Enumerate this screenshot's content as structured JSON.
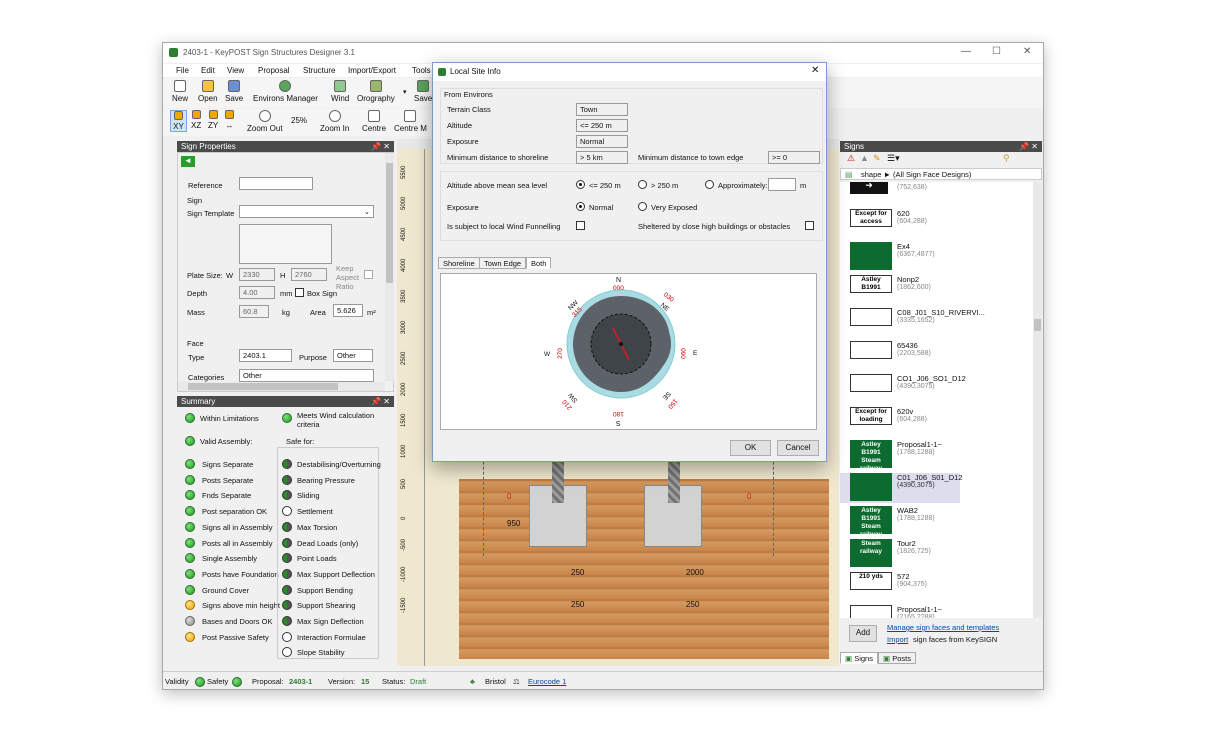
{
  "window": {
    "title": "2403-1 - KeyPOST Sign Structures Designer 3.1",
    "min": "—",
    "max": "☐",
    "close": "✕"
  },
  "menu": [
    "File",
    "Edit",
    "View",
    "Proposal",
    "Structure",
    "Import/Export",
    "Tools"
  ],
  "toolbar": {
    "new": "New",
    "open": "Open",
    "save": "Save",
    "environs": "Environs Manager",
    "wind": "Wind",
    "orography": "Orography",
    "save2": "Save"
  },
  "viewbar": {
    "xy": "XY",
    "xz": "XZ",
    "zy": "ZY",
    "arrows": "↔",
    "zoom_out": "Zoom Out",
    "zoom_level": "25%",
    "zoom_in": "Zoom In",
    "centre": "Centre",
    "centre_m": "Centre M"
  },
  "sign_props": {
    "title": "Sign Properties",
    "pin": "📌 ✕",
    "reference": "Reference",
    "sign": "Sign",
    "template": "Sign Template",
    "plate_size": "Plate Size:",
    "w": "W",
    "w_val": "2330",
    "h": "H",
    "h_val": "2760",
    "keep_aspect": "Keep Aspect Ratio",
    "depth": "Depth",
    "depth_val": "4.00",
    "mm": "mm",
    "box_sign": "Box Sign",
    "mass": "Mass",
    "mass_val": "60.8",
    "kg": "kg",
    "area": "Area",
    "area_val": "5.626",
    "m2": "m²",
    "face": "Face",
    "type": "Type",
    "type_val": "2403.1",
    "purpose": "Purpose",
    "purpose_val": "Other",
    "categories": "Categories",
    "categories_val": "Other"
  },
  "summary": {
    "title": "Summary",
    "within": "Within Limitations",
    "meets": "Meets Wind calculation criteria",
    "valid": "Valid Assembly:",
    "safe_for": "Safe for:",
    "left": [
      {
        "t": "Signs Separate",
        "c": "g"
      },
      {
        "t": "Posts Separate",
        "c": "g"
      },
      {
        "t": "Fnds Separate",
        "c": "g"
      },
      {
        "t": "Post separation OK",
        "c": "g"
      },
      {
        "t": "Signs all in Assembly",
        "c": "g"
      },
      {
        "t": "Posts all in Assembly",
        "c": "g"
      },
      {
        "t": "Single Assembly",
        "c": "g"
      },
      {
        "t": "Posts have Foundation",
        "c": "g"
      },
      {
        "t": "Ground Cover",
        "c": "g"
      },
      {
        "t": "Signs above min height",
        "c": "o"
      },
      {
        "t": "Bases and Doors OK",
        "c": "x"
      },
      {
        "t": "Post Passive Safety",
        "c": "o"
      }
    ],
    "right": [
      {
        "t": "Destabilising/Overturning",
        "c": "h"
      },
      {
        "t": "Bearing Pressure",
        "c": "h"
      },
      {
        "t": "Sliding",
        "c": "h"
      },
      {
        "t": "Settlement",
        "c": "w"
      },
      {
        "t": "Max Torsion",
        "c": "h"
      },
      {
        "t": "Dead Loads (only)",
        "c": "h"
      },
      {
        "t": "Point Loads",
        "c": "h"
      },
      {
        "t": "Max Support Deflection",
        "c": "h"
      },
      {
        "t": "Support Bending",
        "c": "h"
      },
      {
        "t": "Support Shearing",
        "c": "h"
      },
      {
        "t": "Max Sign Deflection",
        "c": "h"
      },
      {
        "t": "Interaction Formulae",
        "c": "w"
      },
      {
        "t": "Slope Stability",
        "c": "w"
      }
    ]
  },
  "drawing": {
    "ruler": [
      "5500",
      "5000",
      "4500",
      "4000",
      "3500",
      "3000",
      "2500",
      "2000",
      "1500",
      "1000",
      "500",
      "0",
      "-500",
      "-1000",
      "-1500"
    ],
    "dim1": "950",
    "dim2": "250",
    "dim3": "2000",
    "dim4": "250",
    "dim5": "250",
    "zero1": "0",
    "zero2": "0"
  },
  "dialog": {
    "title": "Local Site Info",
    "close": "✕",
    "group": "From Environs",
    "terrain": "Terrain Class",
    "terrain_val": "Town",
    "altitude": "Altitude",
    "altitude_val": "<= 250 m",
    "exposure": "Exposure",
    "exposure_val": "Normal",
    "min_shore": "Minimum distance to shoreline",
    "min_shore_val": "> 5 km",
    "min_town": "Minimum distance to town edge",
    "min_town_val": ">= 0",
    "alt_msl": "Altitude above mean sea level",
    "opt_le250": "<= 250 m",
    "opt_gt250": "> 250 m",
    "opt_approx": "Approximately:",
    "approx_unit": "m",
    "exposure2": "Exposure",
    "opt_normal": "Normal",
    "opt_very": "Very Exposed",
    "funnel": "Is subject to local Wind Funnelling",
    "sheltered": "Sheltered by close high buildings or obstacles",
    "tabs": [
      "Shoreline",
      "Town Edge",
      "Both"
    ],
    "ok": "OK",
    "cancel": "Cancel",
    "compass": {
      "n": "N",
      "n_deg": "000",
      "ne": "NE",
      "ne_deg": "030",
      "e": "E",
      "e_deg": "090",
      "se": "SE",
      "se_deg": "150",
      "s": "S",
      "s_deg": "180",
      "sw": "SW",
      "sw_deg": "210",
      "w": "W",
      "w_deg": "270",
      "nw": "NW",
      "nw_deg": "315"
    }
  },
  "signs": {
    "title": "Signs",
    "pin": "📌 ✕",
    "breadcrumb": "shape ► (All Sign Face Designs)",
    "top_size": "(752,638)",
    "items": [
      {
        "name": "620",
        "size": "(604,288)",
        "thumb": "Except for access",
        "style": "white"
      },
      {
        "name": "Ex4",
        "size": "(6367,4877)",
        "thumb": "",
        "style": "green"
      },
      {
        "name": "Nonp2",
        "size": "(1862,600)",
        "thumb": "Astley B1991",
        "style": "white"
      },
      {
        "name": "C08_J01_S10_RIVERVI...",
        "size": "(3335,1652)",
        "thumb": "",
        "style": "white"
      },
      {
        "name": "65436",
        "size": "(2203,588)",
        "thumb": "",
        "style": "white"
      },
      {
        "name": "CO1_J06_SO1_D12",
        "size": "(4390,3075)",
        "thumb": "",
        "style": "white"
      },
      {
        "name": "620v",
        "size": "(604,288)",
        "thumb": "Except for loading",
        "style": "white"
      },
      {
        "name": "Proposal1-1~",
        "size": "(1788,1288)",
        "thumb": "Astley B1991 Steam railway",
        "style": "green"
      },
      {
        "name": "C01_J06_S01_D12",
        "size": "(4390,3075)",
        "thumb": "",
        "style": "green"
      },
      {
        "name": "WAB2",
        "size": "(1788,1288)",
        "thumb": "Astley B1991 Steam railway",
        "style": "green"
      },
      {
        "name": "Tour2",
        "size": "(1826,725)",
        "thumb": "Steam railway",
        "style": "green"
      },
      {
        "name": "572",
        "size": "(904,375)",
        "thumb": "210 yds",
        "style": "white"
      },
      {
        "name": "Proposal1-1~",
        "size": "(2165,2288)",
        "thumb": "",
        "style": "white"
      }
    ],
    "add": "Add",
    "manage": "Manage sign faces and templates",
    "import": "Import",
    "import_rest": " sign faces from KeySIGN",
    "tab_signs": "Signs",
    "tab_posts": "Posts"
  },
  "status": {
    "validity": "Validity",
    "safety": "Safety",
    "proposal_lbl": "Proposal:",
    "proposal": "2403-1",
    "version_lbl": "Version:",
    "version": "15",
    "status_lbl": "Status:",
    "status": "Draft",
    "location": "Bristol",
    "code": "Eurocode 1"
  },
  "colors": {
    "panel_hdr": "#4b4b4b",
    "canvas": "#efe8cf",
    "soil": "#c8844a",
    "dialog_border": "#7a9ccc",
    "compass_ring": "#a8dbe3",
    "link": "#0645ad"
  }
}
